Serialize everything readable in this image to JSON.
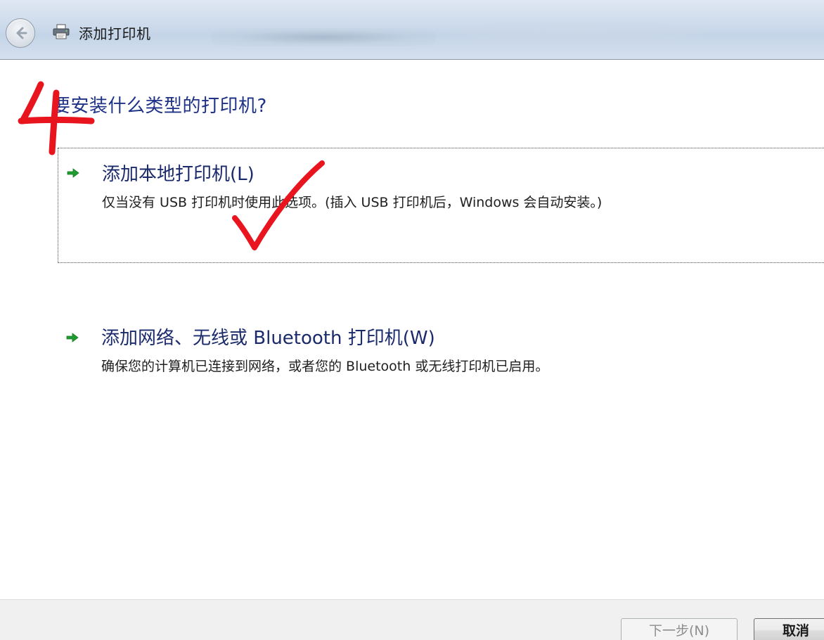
{
  "window": {
    "title": "添加打印机"
  },
  "titlebar": {
    "back_icon": "back-arrow-icon",
    "printer_icon": "printer-icon"
  },
  "main": {
    "heading": "要安装什么类型的打印机?",
    "options": [
      {
        "title": "添加本地打印机(L)",
        "description": "仅当没有 USB 打印机时使用此选项。(插入 USB 打印机后，Windows 会自动安装。)",
        "icon": "green-arrow-icon",
        "selected": true
      },
      {
        "title": "添加网络、无线或 Bluetooth 打印机(W)",
        "description": "确保您的计算机已连接到网络，或者您的 Bluetooth 或无线打印机已启用。",
        "icon": "green-arrow-icon",
        "selected": false
      }
    ]
  },
  "annotations": {
    "step_number": "4",
    "color": "#e8141e"
  },
  "footer": {
    "next_label": "下一步(N)",
    "cancel_label": "取消"
  },
  "colors": {
    "heading": "#1e3287",
    "option_title": "#1a2a6b",
    "arrow": "#1f9b2f"
  }
}
